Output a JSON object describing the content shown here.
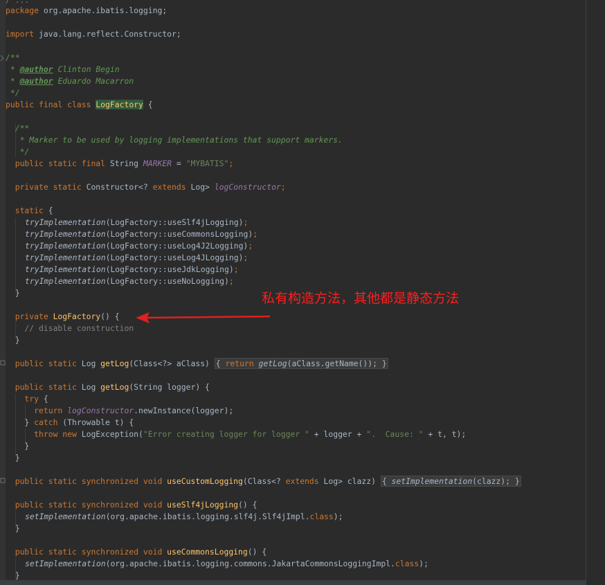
{
  "code": {
    "line0": "/ ...",
    "package_kw": "package",
    "package_name": " org.apache.ibatis.logging;",
    "import_kw": "import",
    "import_name": " java.lang.reflect.Constructor;",
    "doc_open": "/**",
    "author_prefix": " * ",
    "author_tag": "@author",
    "author1_name": " Clinton Begin",
    "author2_name": " Eduardo Macarron",
    "doc_close": " */",
    "class_decl_kw": "public final class ",
    "class_name": "LogFactory",
    "class_brace": " {",
    "marker_doc_open": "  /**",
    "marker_doc_text": "   * Marker to be used by logging implementations that support markers.",
    "marker_doc_close": "   */",
    "marker_kw": "  public static final ",
    "marker_type": "String ",
    "marker_field": "MARKER",
    "marker_eq": " = ",
    "marker_value": "\"MYBATIS\"",
    "marker_semi": ";",
    "ctor_field_kw": "  private static ",
    "ctor_field_type": "Constructor<? ",
    "ctor_field_extends": "extends",
    "ctor_field_type2": " Log> ",
    "ctor_field_name": "logConstructor",
    "ctor_field_semi": ";",
    "static_kw": "  static",
    "static_brace": " {",
    "try_impl": "tryImplementation",
    "try_args": [
      "LogFactory::useSlf4jLogging",
      "LogFactory::useCommonsLogging",
      "LogFactory::useLog4J2Logging",
      "LogFactory::useLog4JLogging",
      "LogFactory::useJdkLogging",
      "LogFactory::useNoLogging"
    ],
    "close_brace": "  }",
    "private_kw": "  private ",
    "private_ctor_name": "LogFactory",
    "private_ctor_tail": "() {",
    "disable_comment": "    // disable construction",
    "getlog1_kw": "  public static ",
    "getlog1_type": "Log ",
    "getlog1_name": "getLog",
    "getlog1_params": "(Class<?> aClass)",
    "getlog1_body_return": "return",
    "getlog1_body_call": "getLog",
    "getlog1_body_args": "(aClass.getName());",
    "getlog2_params": "(String logger) {",
    "try_kw": "    try",
    "return_kw": "      return ",
    "ctor_new_instance": ".newInstance(logger);",
    "catch_open": "    } ",
    "catch_kw": "catch",
    "catch_params": " (Throwable t) {",
    "throw_kw": "      throw new ",
    "throw_type": "LogException(",
    "throw_msg1": "\"Error creating logger for logger \"",
    "throw_plus1": " + logger + ",
    "throw_msg2": "\".  Cause: \"",
    "throw_tail": " + t, t);",
    "inner_close": "    }",
    "use_custom_kw": "  public static synchronized void ",
    "use_custom_name": "useCustomLogging",
    "use_custom_params1": "(Class<? ",
    "use_custom_extends": "extends",
    "use_custom_params2": " Log> clazz)",
    "set_impl": "setImplementation",
    "use_custom_body": "(clazz);",
    "use_slf4j_name": "useSlf4jLogging",
    "method_open": "() {",
    "slf4j_impl": "(org.apache.ibatis.logging.slf4j.Slf4jImpl.",
    "class_kw": "class",
    "impl_close": ");",
    "use_commons_name": "useCommonsLogging",
    "commons_impl": "(org.apache.ibatis.logging.commons.JakartaCommonsLoggingImpl."
  },
  "annotation": {
    "text": "私有构造方法，其他都是静态方法",
    "color": "#ff1e1e"
  },
  "colors": {
    "background": "#2b2b2b",
    "keyword": "#cc7832",
    "string": "#6a8759",
    "doc_comment": "#629755",
    "static_field": "#9876aa",
    "function": "#ffc66d"
  }
}
